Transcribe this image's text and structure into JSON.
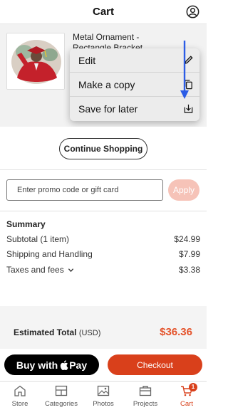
{
  "header": {
    "title": "Cart",
    "account_icon": "user-circle-icon"
  },
  "item": {
    "name": "Metal Ornament - Rectangle Bracket",
    "more_label": "•••"
  },
  "context_menu": {
    "items": [
      {
        "label": "Edit",
        "icon": "pencil-icon"
      },
      {
        "label": "Make a copy",
        "icon": "copy-icon"
      },
      {
        "label": "Save for later",
        "icon": "save-later-icon"
      }
    ]
  },
  "continue_shopping": "Continue Shopping",
  "promo": {
    "placeholder": "Enter promo code or gift card",
    "apply_label": "Apply"
  },
  "summary": {
    "title": "Summary",
    "rows": [
      {
        "label": "Subtotal (1 item)",
        "value": "$24.99"
      },
      {
        "label": "Shipping and Handling",
        "value": "$7.99"
      },
      {
        "label": "Taxes and fees",
        "value": "$3.38"
      }
    ]
  },
  "estimated_total": {
    "label": "Estimated Total",
    "currency": "(USD)",
    "value": "$36.36"
  },
  "buttons": {
    "apple_pay_prefix": "Buy with",
    "apple_pay_suffix": "Pay",
    "checkout": "Checkout"
  },
  "tabbar": {
    "items": [
      {
        "label": "Store",
        "icon": "home-icon"
      },
      {
        "label": "Categories",
        "icon": "categories-icon"
      },
      {
        "label": "Photos",
        "icon": "photos-icon"
      },
      {
        "label": "Projects",
        "icon": "projects-icon"
      },
      {
        "label": "Cart",
        "icon": "cart-icon",
        "badge": "1"
      }
    ]
  },
  "colors": {
    "accent": "#d9401b",
    "total": "#e4532b",
    "highlight": "#2b5ce6",
    "apply_disabled": "#f6c3b8"
  }
}
